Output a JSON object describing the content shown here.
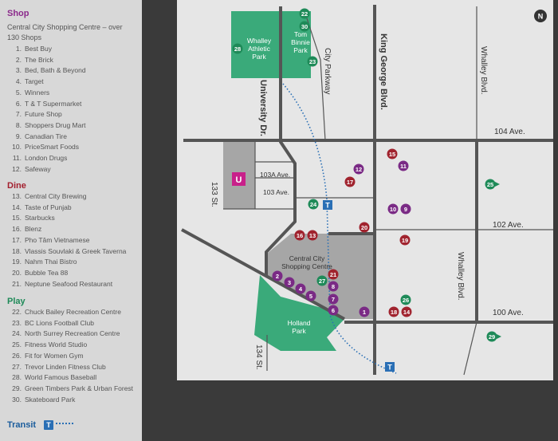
{
  "shop": {
    "title": "Shop",
    "intro": "Central City Shopping Centre – over 130 Shops",
    "items": [
      {
        "num": "1.",
        "name": "Best Buy"
      },
      {
        "num": "2.",
        "name": "The Brick"
      },
      {
        "num": "3.",
        "name": "Bed, Bath & Beyond"
      },
      {
        "num": "4.",
        "name": "Target"
      },
      {
        "num": "5.",
        "name": "Winners"
      },
      {
        "num": "6.",
        "name": "T & T Supermarket"
      },
      {
        "num": "7.",
        "name": "Future Shop"
      },
      {
        "num": "8.",
        "name": "Shoppers Drug Mart"
      },
      {
        "num": "9.",
        "name": "Canadian Tire"
      },
      {
        "num": "10.",
        "name": "PriceSmart Foods"
      },
      {
        "num": "11.",
        "name": "London Drugs"
      },
      {
        "num": "12.",
        "name": "Safeway"
      }
    ]
  },
  "dine": {
    "title": "Dine",
    "items": [
      {
        "num": "13.",
        "name": "Central City Brewing"
      },
      {
        "num": "14.",
        "name": "Taste of Punjab"
      },
      {
        "num": "15.",
        "name": "Starbucks"
      },
      {
        "num": "16.",
        "name": "Blenz"
      },
      {
        "num": "17.",
        "name": "Pho Tâm Vietnamese"
      },
      {
        "num": "18.",
        "name": "Vlassis Souvlaki & Greek Taverna"
      },
      {
        "num": "19.",
        "name": "Nahm Thai Bistro"
      },
      {
        "num": "20.",
        "name": "Bubble Tea 88"
      },
      {
        "num": "21.",
        "name": "Neptune Seafood Restaurant"
      }
    ]
  },
  "play": {
    "title": "Play",
    "items": [
      {
        "num": "22.",
        "name": "Chuck Bailey Recreation Centre"
      },
      {
        "num": "23.",
        "name": "BC Lions Football Club"
      },
      {
        "num": "24.",
        "name": "North Surrey Recreation Centre"
      },
      {
        "num": "25.",
        "name": "Fitness World Studio"
      },
      {
        "num": "26.",
        "name": "Fit for Women Gym"
      },
      {
        "num": "27.",
        "name": "Trevor Linden Fitness Club"
      },
      {
        "num": "28.",
        "name": "World Famous Baseball"
      },
      {
        "num": "29.",
        "name": "Green Timbers Park & Urban Forest"
      },
      {
        "num": "30.",
        "name": "Skateboard Park"
      }
    ]
  },
  "transit": {
    "title": "Transit",
    "badge": "T"
  },
  "map": {
    "north_label": "N",
    "university_badge": "U",
    "streets": {
      "university": "University Dr.",
      "city_parkway": "City Parkway",
      "king_george": "King George Blvd.",
      "whalley_top": "Whalley Blvd.",
      "whalley_bottom": "Whalley Blvd.",
      "ave104": "104 Ave.",
      "ave103a": "103A Ave.",
      "ave103": "103 Ave.",
      "ave102": "102 Ave.",
      "ave100": "100 Ave.",
      "st133": "133 St.",
      "st134": "134 St."
    },
    "places": {
      "whalley_park": "Whalley Athletic Park",
      "tom_binnie": "Tom Binnie Park",
      "central_city": "Central City Shopping Centre",
      "holland": "Holland Park"
    },
    "colors": {
      "shop": "#7a2a85",
      "dine": "#a0232e",
      "play": "#1e8a58",
      "transit": "#2a6fb5",
      "park": "#3aaa7a",
      "building": "#a6a6a6",
      "road": "#555555"
    }
  }
}
